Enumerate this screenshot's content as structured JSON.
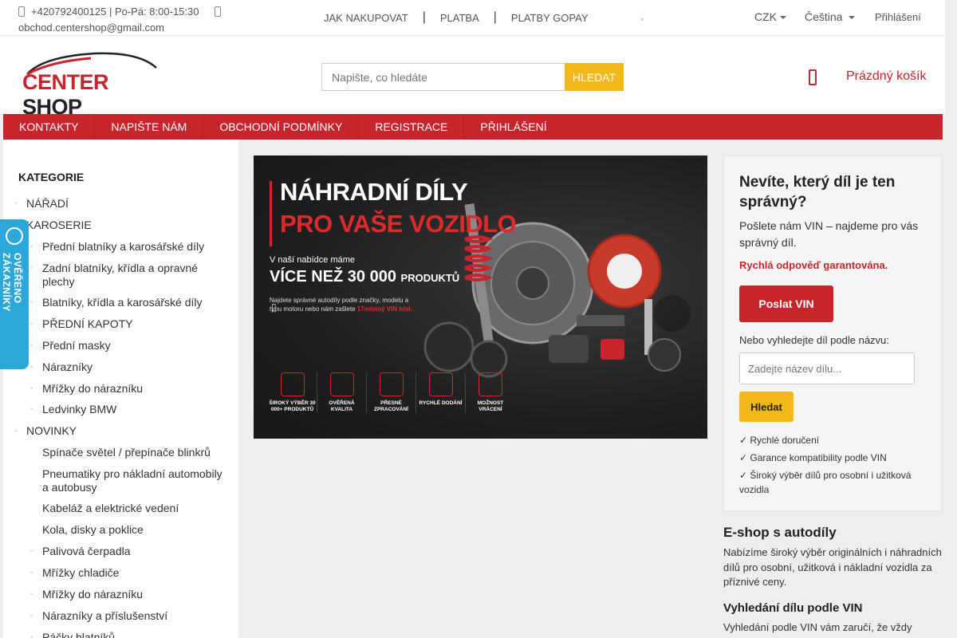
{
  "topbar": {
    "phone_hours": "+420792400125 | Po-Pá: 8:00-15:30",
    "email": "obchod.centershop@gmail.com",
    "links": [
      "JAK NAKUPOVAT",
      "PLATBA",
      "PLATBY GOPAY"
    ],
    "currency": "CZK",
    "language": "Čeština",
    "login": "Přihlášení"
  },
  "header": {
    "logo_brand_a": "CENTER",
    "logo_brand_b": "SHOP",
    "search_placeholder": "Napište, co hledáte",
    "search_button": "HLEDAT",
    "cart_label": "Prázdný košík"
  },
  "nav": {
    "items": [
      "KONTAKTY",
      "NAPIŠTE NÁM",
      "OBCHODNÍ PODMÍNKY",
      "REGISTRACE",
      "PŘIHLÁŠENÍ"
    ]
  },
  "sidebar": {
    "title": "KATEGORIE",
    "items": [
      {
        "label": "NÁŘADÍ",
        "level": 0
      },
      {
        "label": "KAROSERIE",
        "level": 0
      },
      {
        "label": "Přední blatníky a karosářské díly",
        "level": 1
      },
      {
        "label": "Zadní blatníky, křídla a opravné plechy",
        "level": 1
      },
      {
        "label": "Blatníky, křídla a karosářské díly",
        "level": 1
      },
      {
        "label": "PŘEDNÍ KAPOTY",
        "level": 1
      },
      {
        "label": "Přední masky",
        "level": 1
      },
      {
        "label": "Nárazníky",
        "level": 1
      },
      {
        "label": "Mřížky do nárazníku",
        "level": 1
      },
      {
        "label": "Ledvinky BMW",
        "level": 1
      },
      {
        "label": "NOVINKY",
        "level": 0
      },
      {
        "label": "Spínače světel / přepínače blinkrů",
        "level": 1
      },
      {
        "label": "Pneumatiky pro nákladní automobily a autobusy",
        "level": 1
      },
      {
        "label": "Kabeláž a elektrické vedení",
        "level": 1
      },
      {
        "label": "Kola, disky a poklice",
        "level": 1
      },
      {
        "label": "Palivová čerpadla",
        "level": 1
      },
      {
        "label": "Mřížky chladiče",
        "level": 1
      },
      {
        "label": "Mřížky do nárazníku",
        "level": 1
      },
      {
        "label": "Nárazníky a příslušenství",
        "level": 1
      },
      {
        "label": "Páčky blatníků",
        "level": 1
      }
    ]
  },
  "badge": {
    "text": "OVĚŘENO ZÁKAZNÍKY"
  },
  "banner": {
    "title_line1": "NÁHRADNÍ DÍLY",
    "title_line2": "PRO VAŠE VOZIDLO",
    "sub_line1": "V naší nabídce máme",
    "sub_line2_a": "VÍCE NEŽ 30 000",
    "sub_line2_b": "PRODUKTŮ",
    "sub_line3_a": "Najdete správné autodíly podle značky, modelu a typu motoru nebo nám zašlete",
    "sub_line3_b": "17místný VIN kód.",
    "features": [
      "ŠIROKÝ VÝBĚR 30 000+ PRODUKTŮ",
      "OVĚŘENÁ KVALITA",
      "PŘESNÉ ZPRACOVÁNÍ",
      "RYCHLÉ DODÁNÍ",
      "MOŽNOST VRÁCENÍ"
    ]
  },
  "vin_box": {
    "title": "Nevíte, který díl je ten správný?",
    "description": "Pošlete nám VIN – najdeme pro vás správný díl.",
    "guarantee": "Rychlá odpověď garantována.",
    "send_button": "Poslat VIN",
    "or_label": "Nebo vyhledejte díl podle názvu:",
    "input_placeholder": "Zadejte název dílu...",
    "search_button": "Hledat",
    "features": [
      "✓ Rychlé doručení",
      "✓ Garance kompatibility podle VIN",
      "✓ Široký výběr dílů pro osobní i užitková vozidla"
    ]
  },
  "info": {
    "eshop_title": "E-shop s autodíly",
    "eshop_text": "Nabízíme široký výběr originálních i náhradních dílů pro osobní, užitková i nákladní vozidla za příznivé ceny.",
    "vin_title": "Vyhledání dílu podle VIN",
    "vin_text": "Vyhledání podle VIN vám zaručí, že vždy"
  },
  "colors": {
    "brand_red": "#c8242b",
    "accent_yellow": "#f2b718",
    "badge_blue": "#2ba8d8"
  }
}
